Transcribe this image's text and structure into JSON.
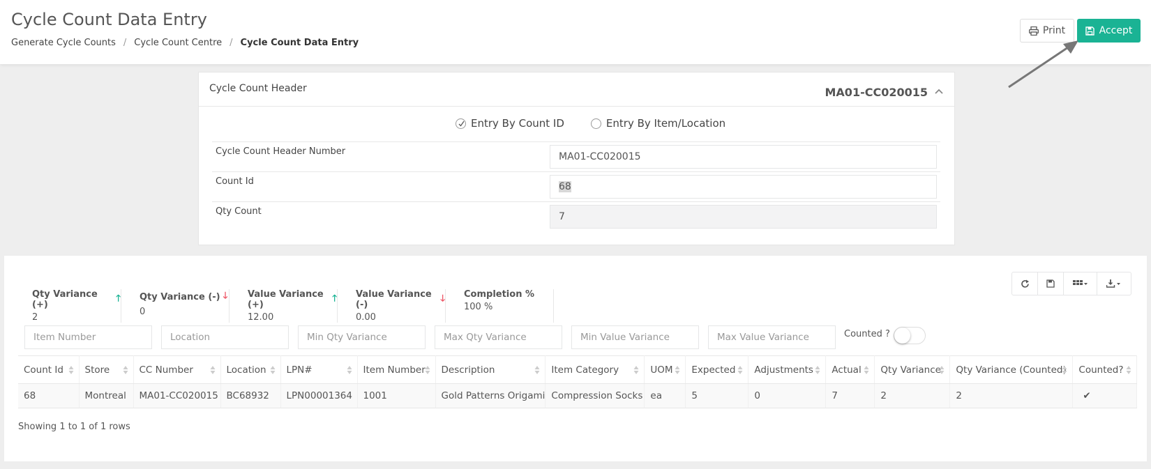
{
  "header": {
    "title": "Cycle Count Data Entry",
    "breadcrumb": [
      "Generate Cycle Counts",
      "Cycle Count Centre",
      "Cycle Count Data Entry"
    ],
    "print_label": "Print",
    "accept_label": "Accept",
    "accent_color": "#1ab394"
  },
  "panel": {
    "title": "Cycle Count Header",
    "header_id": "MA01-CC020015",
    "radio_count_id": "Entry By Count ID",
    "radio_item_location": "Entry By Item/Location",
    "selected_mode": "Entry By Count ID",
    "fields": [
      {
        "label": "Cycle Count Header Number",
        "value": "MA01-CC020015"
      },
      {
        "label": "Count Id",
        "value": "68"
      },
      {
        "label": "Qty Count",
        "value": "7"
      }
    ]
  },
  "summary": [
    {
      "label": "Qty Variance (+)",
      "value": "2",
      "trend": "up"
    },
    {
      "label": "Qty Variance (-)",
      "value": "0",
      "trend": "down"
    },
    {
      "label": "Value Variance (+)",
      "value": "12.00",
      "trend": "up"
    },
    {
      "label": "Value Variance (-)",
      "value": "0.00",
      "trend": "down"
    },
    {
      "label": "Completion %",
      "value": "100 %",
      "trend": ""
    }
  ],
  "filters": {
    "item_number": "Item Number",
    "location": "Location",
    "min_qty": "Min Qty Variance",
    "max_qty": "Max Qty Variance",
    "min_value": "Min Value Variance",
    "max_value": "Max Value Variance",
    "counted_label": "Counted ?",
    "counted_on": false
  },
  "toolbar": {
    "icons": [
      "refresh-icon",
      "save-icon",
      "columns-icon",
      "export-icon"
    ]
  },
  "table": {
    "columns": [
      "Count Id",
      "Store",
      "CC Number",
      "Location",
      "LPN#",
      "Item Number",
      "Description",
      "Item Category",
      "UOM",
      "Expected",
      "Adjustments",
      "Actual",
      "Qty Variance",
      "Qty Variance (Counted)",
      "Counted?"
    ],
    "rows": [
      [
        "68",
        "Montreal",
        "MA01-CC020015",
        "BC68932",
        "LPN00001364",
        "1001",
        "Gold Patterns Origami",
        "Compression Socks",
        "ea",
        "5",
        "0",
        "7",
        "2",
        "2",
        "✔"
      ]
    ],
    "footer": "Showing 1 to 1 of 1 rows"
  }
}
